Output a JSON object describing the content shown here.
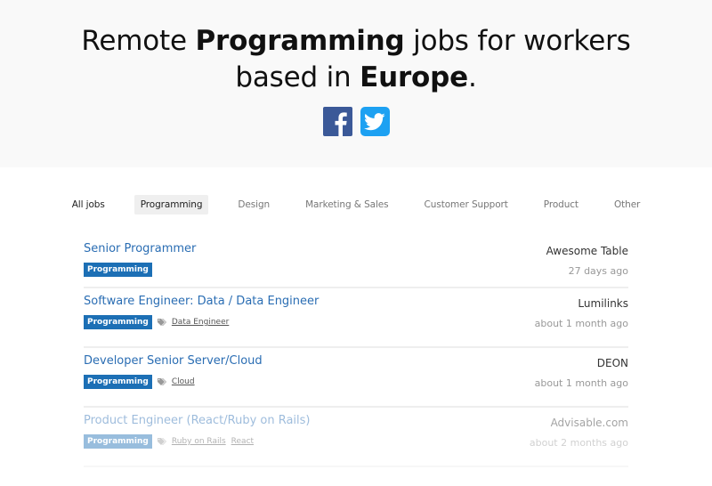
{
  "hero": {
    "title_pre": "Remote ",
    "title_bold1": "Programming",
    "title_mid": " jobs for workers based in ",
    "title_bold2": "Europe",
    "title_post": ".",
    "social": [
      {
        "name": "facebook",
        "icon": "facebook-icon",
        "color": "#3b5998"
      },
      {
        "name": "twitter",
        "icon": "twitter-icon",
        "color": "#1da1f2"
      }
    ]
  },
  "tabs": [
    {
      "label": "All jobs",
      "active": false
    },
    {
      "label": "Programming",
      "active": true
    },
    {
      "label": "Design",
      "active": false
    },
    {
      "label": "Marketing & Sales",
      "active": false
    },
    {
      "label": "Customer Support",
      "active": false
    },
    {
      "label": "Product",
      "active": false
    },
    {
      "label": "Other",
      "active": false
    }
  ],
  "jobs": [
    {
      "title": "Senior Programmer",
      "category": "Programming",
      "tags": [],
      "company": "Awesome Table",
      "date": "27 days ago"
    },
    {
      "title": "Software Engineer: Data / Data Engineer",
      "category": "Programming",
      "tags": [
        "Data Engineer"
      ],
      "company": "Lumilinks",
      "date": "about 1 month ago"
    },
    {
      "title": "Developer Senior Server/Cloud",
      "category": "Programming",
      "tags": [
        "Cloud"
      ],
      "company": "DEON",
      "date": "about 1 month ago"
    },
    {
      "title": "Product Engineer (React/Ruby on Rails)",
      "category": "Programming",
      "tags": [
        "Ruby on Rails",
        "React"
      ],
      "company": "Advisable.com",
      "date": "about 2 months ago",
      "faded": true
    }
  ],
  "colors": {
    "link": "#2a6db3",
    "badge": "#1c6fb5",
    "hero_bg": "#f9f9f9",
    "active_tab_bg": "#efefef"
  }
}
